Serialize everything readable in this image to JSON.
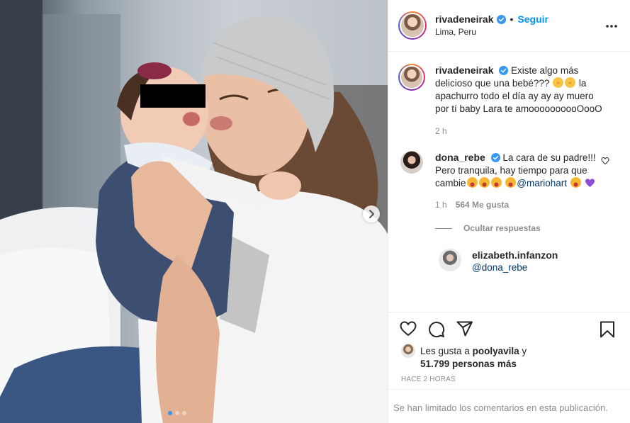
{
  "photo": {
    "carousel_dots": 3,
    "active_dot": 0
  },
  "header": {
    "username": "rivadeneirak",
    "separator": "•",
    "follow_label": "Seguir",
    "location": "Lima, Peru"
  },
  "caption": {
    "username": "rivadeneirak",
    "text": "Existe algo más delicioso que una bebé???",
    "text2": "la apachurro todo el día ay ay ay muero por tí baby Lara te amoooooooooOooO",
    "time": "2 h"
  },
  "comment": {
    "username": "dona_rebe",
    "text": "La cara de su padre!!! Pero tranquila, hay tiempo para que cambie",
    "mention": "@mariohart",
    "time": "1 h",
    "likes": "564 Me gusta",
    "toggle_replies": "Ocultar respuestas"
  },
  "reply": {
    "username": "elizabeth.infanzon",
    "mention": "@dona_rebe"
  },
  "likes": {
    "prefix": "Les gusta a",
    "liker": "poolyavila",
    "conj": "y",
    "others": "51.799 personas más"
  },
  "time_ago": "HACE 2 HORAS",
  "limited_comments": "Se han limitado los comentarios en esta publicación.",
  "colors": {
    "accent": "#0095f6",
    "muted": "#8e8e8e",
    "text": "#262626",
    "dot_active": "#3897f0"
  },
  "icons": [
    "verified-badge-icon",
    "more-options-icon",
    "heart-icon",
    "comment-icon",
    "share-icon",
    "bookmark-icon",
    "chevron-right-icon"
  ]
}
